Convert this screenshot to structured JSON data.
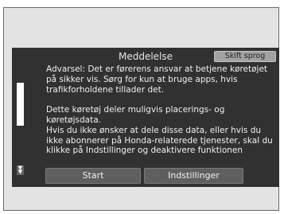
{
  "dialog": {
    "title": "Meddelelse",
    "language_button": "Skift sprog",
    "message": [
      "Advarsel: Det er førerens ansvar at betjene køretøjet",
      "på sikker vis. Sørg for kun at bruge apps, hvis",
      "trafikforholdene tillader det.",
      "",
      "Dette køretøj deler muligvis placerings- og",
      "køretøjsdata.",
      "Hvis du ikke ønsker at dele disse data, eller hvis du",
      "ikke abonnerer på Honda-relaterede tjenester, skal du",
      "klikke på Indstillinger og deaktivere funktionen"
    ],
    "buttons": {
      "start": "Start",
      "settings": "Indstillinger"
    },
    "scroll_down_icon": "double-chevron-down-icon"
  }
}
